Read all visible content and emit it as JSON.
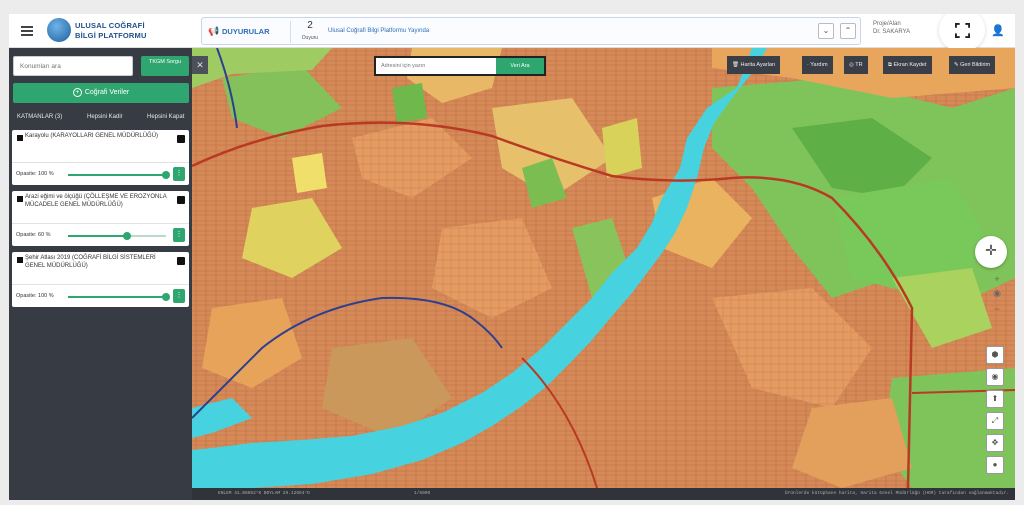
{
  "header": {
    "logo_line1": "ULUSAL COĞRAFİ",
    "logo_line2": "BİLGİ PLATFORMU",
    "announcements_title": "DUYURULAR",
    "announcement_count": "2",
    "announcement_count_label": "Duyuru",
    "announcement_message": "Ulusal Coğrafi Bilgi Platformu Yayında",
    "user_line1": "Proje/Alan",
    "user_line2": "Dr. SAKARYA"
  },
  "sidebar": {
    "location_placeholder": "Konumları ara",
    "tkgm_button": "TKGM Sorgu",
    "geo_data_button": "Coğrafi Veriler",
    "layers_title": "KATMANLAR (3)",
    "close_all": "Hepsini Kadir",
    "open_all": "Hepsini Kapat",
    "layers": [
      {
        "name": "Karayolu (KARAYOLLARI GENEL MÜDÜRLÜĞÜ)",
        "opacity_label": "Opasite: 100 %",
        "opacity": 100
      },
      {
        "name": "Arazi eğimi ve ölçüğü (ÇÖLLEŞME VE EROZYONLA MÜCADELE GENEL MÜDÜRLÜĞÜ)",
        "opacity_label": "Opasite: 60 %",
        "opacity": 60
      },
      {
        "name": "Şehir Atlası 2019 (COĞRAFİ BİLGİ SİSTEMLERİ GENEL MÜDÜRLÜĞÜ)",
        "opacity_label": "Opasite: 100 %",
        "opacity": 100
      }
    ]
  },
  "map": {
    "search_placeholder": "Adresini için yazın",
    "search_button": "Veri Ara",
    "tools": {
      "map_settings": "Harita Ayarları",
      "help": "Yardım",
      "language": "TR",
      "screenshot": "Ekran Kaydet",
      "feedback": "Geri Bildirim"
    },
    "status_coords": "ENLEM 41.08652°K   BOYLAM 29.12654°D",
    "status_scale": "1/5000",
    "status_credit": "Ürünlerde kütüphane harita, Harita Genel Müdürlüğü (HGM) tarafından sağlanmaktadır."
  },
  "colors": {
    "accent_green": "#2fa66f",
    "sidebar_bg": "#373c44",
    "water": "#46d3df",
    "urban": "#d58a58",
    "forest": "#7dbf55",
    "road": "#b93a24",
    "highway": "#2d3f8f"
  },
  "icons": [
    "hamburger-icon",
    "logo-icon",
    "megaphone-icon",
    "fullscreen-icon",
    "user-icon",
    "compass-icon",
    "layers-icon",
    "eye-icon",
    "pin-icon",
    "expand-icon",
    "move-icon",
    "globe-icon"
  ]
}
